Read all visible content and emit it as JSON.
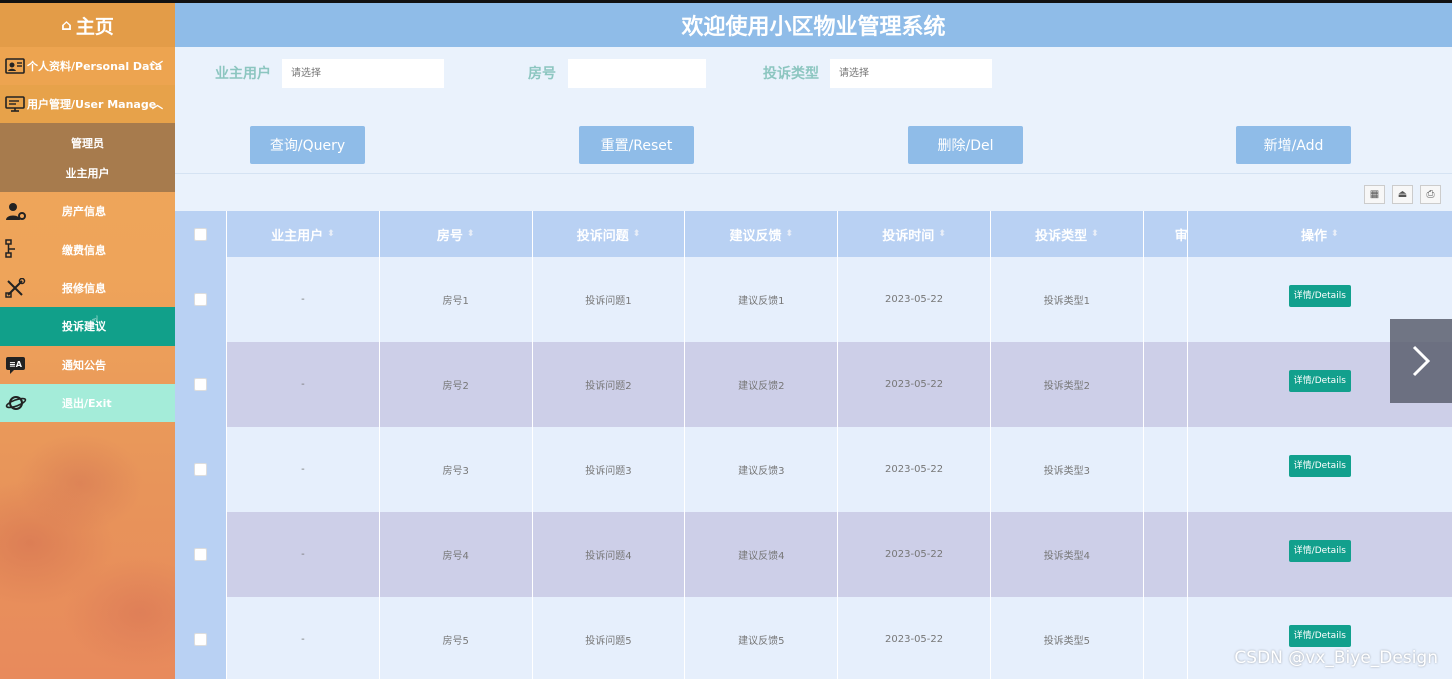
{
  "sidebar": {
    "home_label": "主页",
    "groups": [
      {
        "label": "个人资料/Personal Data"
      },
      {
        "label": "用户管理/User Manage"
      }
    ],
    "sub_items": [
      {
        "label": "管理员"
      },
      {
        "label": "业主用户"
      }
    ],
    "items": [
      {
        "label": "房产信息"
      },
      {
        "label": "缴费信息"
      },
      {
        "label": "报修信息"
      },
      {
        "label": "投诉建议"
      },
      {
        "label": "通知公告"
      },
      {
        "label": "退出/Exit"
      }
    ]
  },
  "header": {
    "title": "欢迎使用小区物业管理系统"
  },
  "filters": {
    "owner_label": "业主用户",
    "owner_placeholder": "请选择",
    "room_label": "房号",
    "room_value": "",
    "type_label": "投诉类型",
    "type_placeholder": "请选择"
  },
  "buttons": {
    "query": "查询/Query",
    "reset": "重置/Reset",
    "delete": "删除/Del",
    "add": "新增/Add"
  },
  "table": {
    "headers": [
      "业主用户",
      "房号",
      "投诉问题",
      "建议反馈",
      "投诉时间",
      "投诉类型",
      "审",
      "操作"
    ],
    "detail_label": "详情/Details",
    "rows": [
      [
        "-",
        "房号1",
        "投诉问题1",
        "建议反馈1",
        "2023-05-22",
        "投诉类型1"
      ],
      [
        "-",
        "房号2",
        "投诉问题2",
        "建议反馈2",
        "2023-05-22",
        "投诉类型2"
      ],
      [
        "-",
        "房号3",
        "投诉问题3",
        "建议反馈3",
        "2023-05-22",
        "投诉类型3"
      ],
      [
        "-",
        "房号4",
        "投诉问题4",
        "建议反馈4",
        "2023-05-22",
        "投诉类型4"
      ],
      [
        "-",
        "房号5",
        "投诉问题5",
        "建议反馈5",
        "2023-05-22",
        "投诉类型5"
      ]
    ]
  },
  "watermark": "CSDN @vx_Biye_Design",
  "colors": {
    "header_bg": "#8fbce8",
    "sidebar_bg": "#eea45a",
    "active_item": "#11a08a",
    "detail_button": "#12a08d"
  }
}
